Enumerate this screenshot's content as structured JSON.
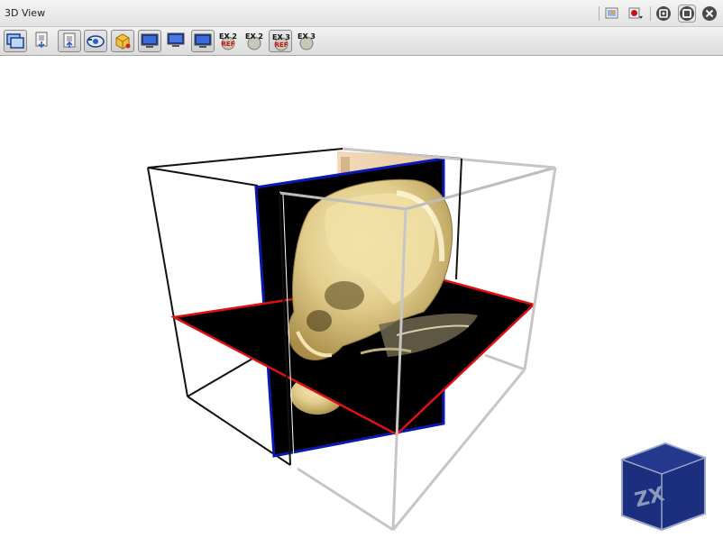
{
  "window": {
    "title": "3D View"
  },
  "toolbar": {
    "tools": [
      {
        "name": "window-layout",
        "pressed": true
      },
      {
        "name": "import-volume",
        "pressed": false
      },
      {
        "name": "export-volume",
        "pressed": true
      },
      {
        "name": "camera",
        "pressed": true
      },
      {
        "name": "volume-render",
        "pressed": true
      },
      {
        "name": "monitor-1",
        "pressed": true
      },
      {
        "name": "monitor-2",
        "pressed": false
      },
      {
        "name": "monitor-3",
        "pressed": true
      }
    ],
    "ex_buttons": [
      {
        "label": "EX 2",
        "sub": "REF",
        "pressed": false
      },
      {
        "label": "EX 2",
        "sub": "",
        "pressed": false
      },
      {
        "label": "EX 3",
        "sub": "REF",
        "pressed": true
      },
      {
        "label": "EX 3",
        "sub": "",
        "pressed": false
      }
    ]
  },
  "orientation_cube": {
    "label": "ZX",
    "color": "#1c2f7e"
  },
  "colors": {
    "axial_plane_border": "#e01010",
    "sagittal_plane_border": "#0a1ab0",
    "bone": "#e6d49a"
  }
}
